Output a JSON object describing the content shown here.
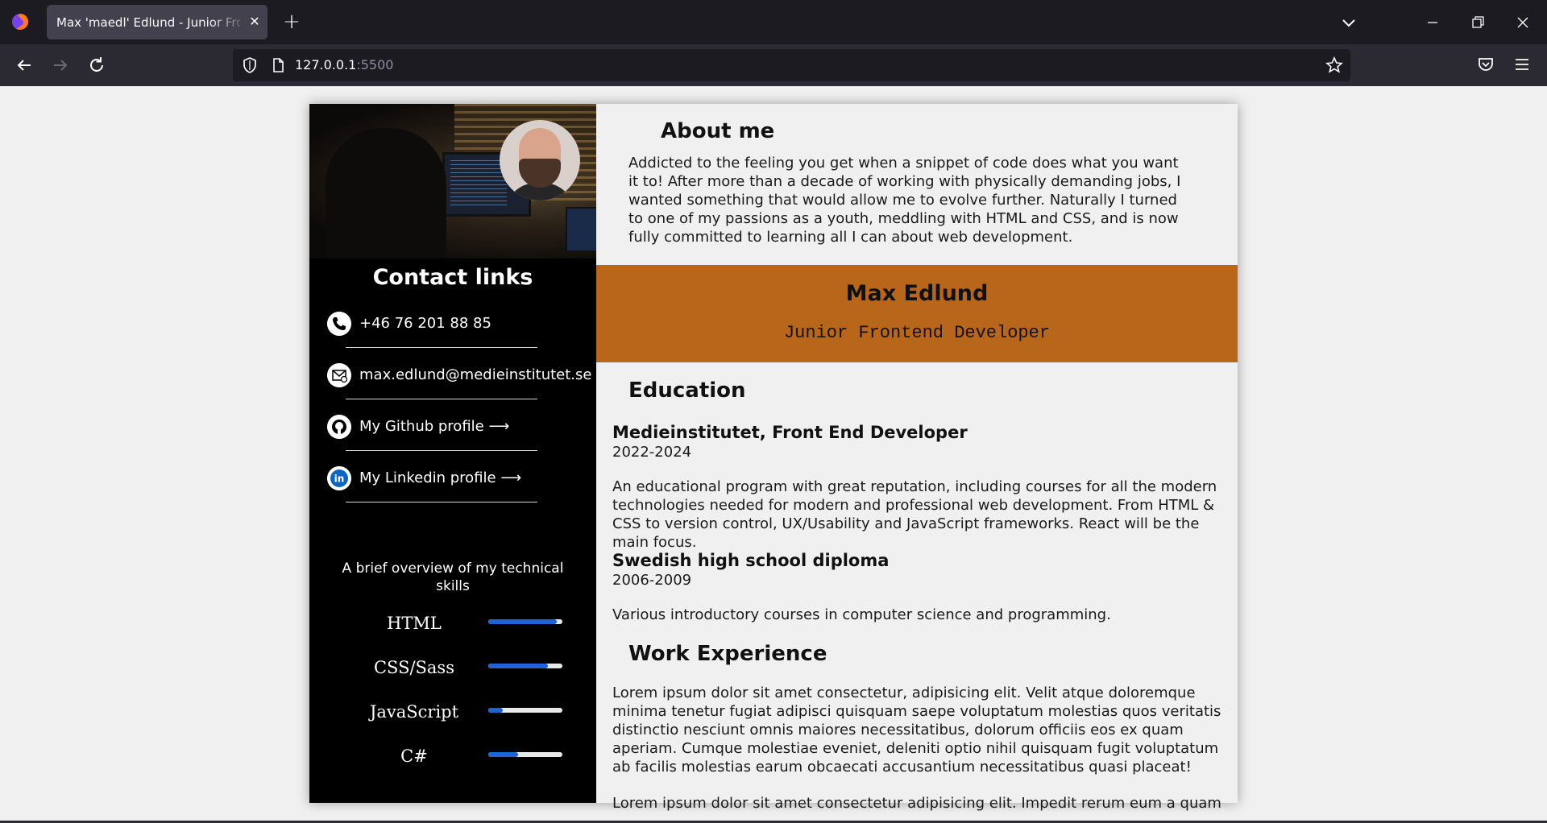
{
  "browser": {
    "tab_title": "Max 'maedl' Edlund - Junior Frontend Developer",
    "url_host": "127.0.0.1",
    "url_port": ":5500"
  },
  "sidebar": {
    "contact_title": "Contact links",
    "contacts": [
      {
        "label": "+46 76 201 88 85",
        "icon": "phone-icon"
      },
      {
        "label": "max.edlund@medieinstitutet.se",
        "icon": "email-icon"
      },
      {
        "label": "My Github profile ⟶",
        "icon": "github-icon"
      },
      {
        "label": "My Linkedin profile ⟶",
        "icon": "linkedin-icon"
      }
    ],
    "skills_intro": "A brief overview of my technical skills",
    "skills": [
      {
        "name": "HTML",
        "level": 0.92
      },
      {
        "name": "CSS/Sass",
        "level": 0.8
      },
      {
        "name": "JavaScript",
        "level": 0.2
      },
      {
        "name": "C#",
        "level": 0.4
      }
    ]
  },
  "about": {
    "title": "About me",
    "text": "Addicted to the feeling you get when a snippet of code does what you want it to! After more than a decade of working with physically demanding jobs, I wanted something that would allow me to evolve further. Naturally I turned to one of my passions as a youth, meddling with HTML and CSS, and is now fully committed to learning all I can about web development."
  },
  "banner": {
    "name": "Max Edlund",
    "role": "Junior Frontend Developer",
    "color": "#b8661a"
  },
  "education": {
    "title": "Education",
    "items": [
      {
        "heading": "Medieinstitutet, Front End Developer",
        "years": "2022-2024",
        "text": "An educational program with great reputation, including courses for all the modern technologies needed for modern and professional web development. From HTML & CSS to version control, UX/Usability and JavaScript frameworks. React will be the main focus."
      },
      {
        "heading": "Swedish high school diploma",
        "years": "2006-2009",
        "text": "Various introductory courses in computer science and programming."
      }
    ]
  },
  "work": {
    "title": "Work Experience",
    "text": "Lorem ipsum dolor sit amet consectetur, adipisicing elit. Velit atque doloremque minima tenetur fugiat adipisci quisquam saepe voluptatum molestias quos veritatis distinctio nesciunt omnis maiores necessitatibus, dolorum officiis eos ex quam aperiam. Cumque molestiae eveniet, deleniti optio nihil quisquam fugit voluptatum ab facilis molestias earum obcaecati accusantium necessitatibus quasi placeat!",
    "text2": "Lorem ipsum dolor sit amet consectetur adipisicing elit. Impedit rerum eum a quam"
  }
}
